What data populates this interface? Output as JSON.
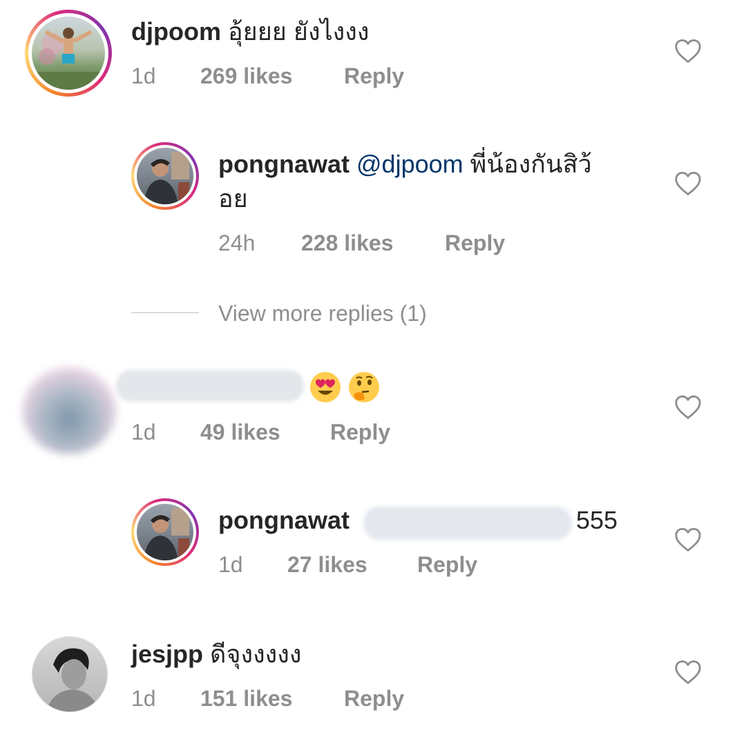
{
  "comments": [
    {
      "username": "djpoom",
      "text": "อุ้ยยย ยังไงงง",
      "time": "1d",
      "likes": "269 likes",
      "reply": "Reply"
    },
    {
      "username": "pongnawat",
      "mention": "@djpoom",
      "text_line1": "พี่น้องกันสิว้",
      "text_line2": "อย",
      "time": "24h",
      "likes": "228 likes",
      "reply": "Reply"
    },
    {
      "view_more": "View more replies (1)"
    },
    {
      "username": "",
      "text": "",
      "time": "1d",
      "likes": "49 likes",
      "reply": "Reply"
    },
    {
      "username": "pongnawat",
      "text": "555",
      "time": "1d",
      "likes": "27 likes",
      "reply": "Reply"
    },
    {
      "username": "jesjpp",
      "text": "ดีจุงงงงง",
      "time": "1d",
      "likes": "151 likes",
      "reply": "Reply"
    }
  ],
  "icons": {
    "heart": "heart-outline-icon",
    "emoji_1": "heart-eyes-emoji-icon",
    "emoji_2": "thinking-face-emoji-icon"
  },
  "colors": {
    "text": "#262626",
    "meta": "#8e8e8e",
    "mention": "#003569",
    "story_ring": "#dd2a7b"
  }
}
